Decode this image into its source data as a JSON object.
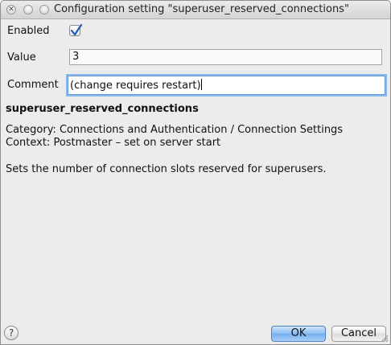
{
  "window": {
    "title": "Configuration setting \"superuser_reserved_connections\""
  },
  "form": {
    "enabled_label": "Enabled",
    "enabled_checked": true,
    "value_label": "Value",
    "value": "3",
    "comment_label": "Comment",
    "comment": "(change requires restart)"
  },
  "info": {
    "param_name": "superuser_reserved_connections",
    "category": "Category: Connections and Authentication / Connection Settings",
    "context": "Context: Postmaster – set on server start",
    "description": "Sets the number of connection slots reserved for superusers."
  },
  "buttons": {
    "help": "?",
    "ok": "OK",
    "cancel": "Cancel"
  },
  "icons": {
    "close": "close-icon",
    "minimize": "minimize-icon",
    "maximize": "maximize-icon",
    "check": "checkmark-icon",
    "grip": "resize-grip-icon"
  },
  "colors": {
    "focus_ring": "#8cb8ea",
    "check": "#1f5cb3",
    "ok_button": "#8bbdf3"
  }
}
